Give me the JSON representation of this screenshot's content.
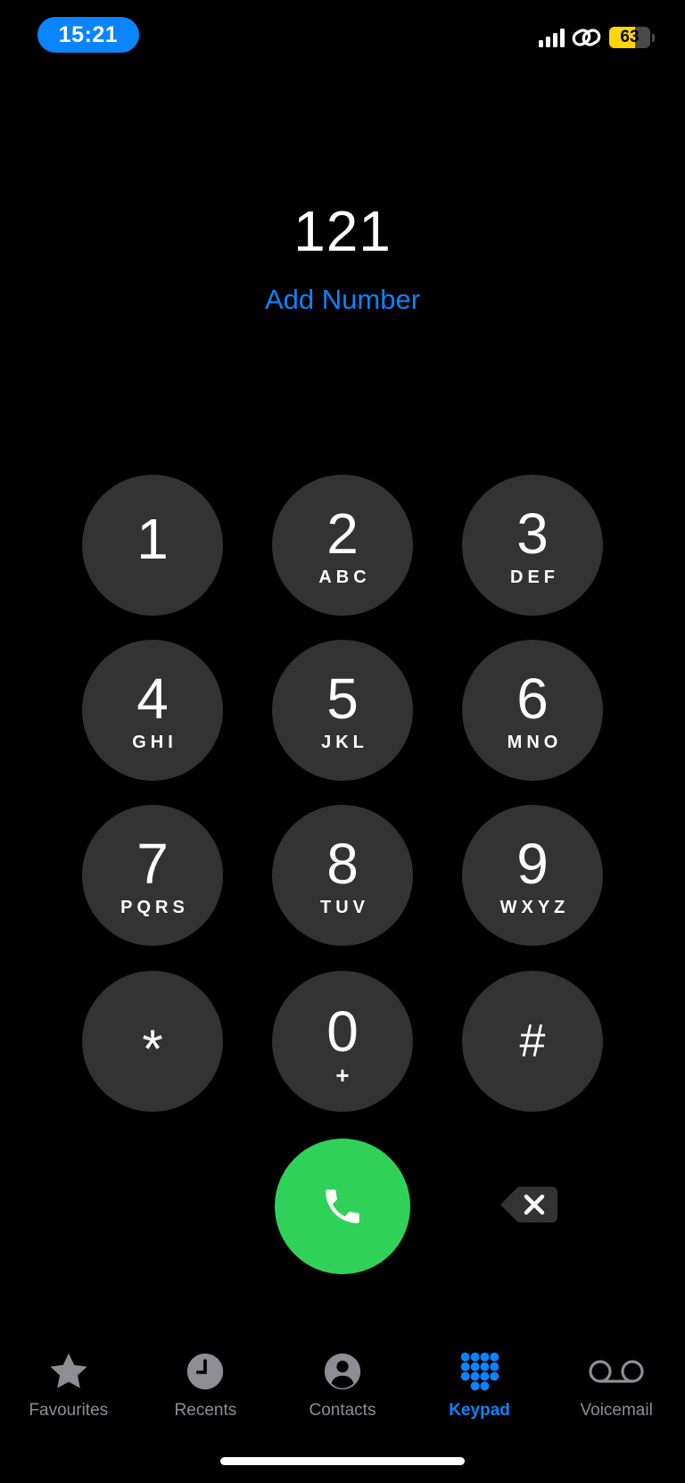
{
  "status_bar": {
    "time": "15:21",
    "battery_level": "63",
    "battery_fraction": 0.63,
    "battery_color": "#ffd60a",
    "icons": [
      "cellular-signal-icon",
      "personal-hotspot-link-icon",
      "battery-icon"
    ]
  },
  "dialer": {
    "number": "121",
    "add_number_label": "Add Number",
    "accent_color": "#0a84ff"
  },
  "keypad": {
    "keys": [
      {
        "digit": "1",
        "letters": ""
      },
      {
        "digit": "2",
        "letters": "ABC"
      },
      {
        "digit": "3",
        "letters": "DEF"
      },
      {
        "digit": "4",
        "letters": "GHI"
      },
      {
        "digit": "5",
        "letters": "JKL"
      },
      {
        "digit": "6",
        "letters": "MNO"
      },
      {
        "digit": "7",
        "letters": "PQRS"
      },
      {
        "digit": "8",
        "letters": "TUV"
      },
      {
        "digit": "9",
        "letters": "WXYZ"
      },
      {
        "digit": "*",
        "letters": ""
      },
      {
        "digit": "0",
        "letters": "+"
      },
      {
        "digit": "#",
        "letters": ""
      }
    ],
    "call_icon": "phone-icon",
    "call_color": "#30d158",
    "delete_icon": "delete-backspace-icon"
  },
  "tabbar": {
    "tabs": [
      {
        "label": "Favourites",
        "icon": "star-icon",
        "active": false
      },
      {
        "label": "Recents",
        "icon": "clock-icon",
        "active": false
      },
      {
        "label": "Contacts",
        "icon": "person-circle-icon",
        "active": false
      },
      {
        "label": "Keypad",
        "icon": "keypad-grid-icon",
        "active": true
      },
      {
        "label": "Voicemail",
        "icon": "voicemail-icon",
        "active": false
      }
    ]
  }
}
